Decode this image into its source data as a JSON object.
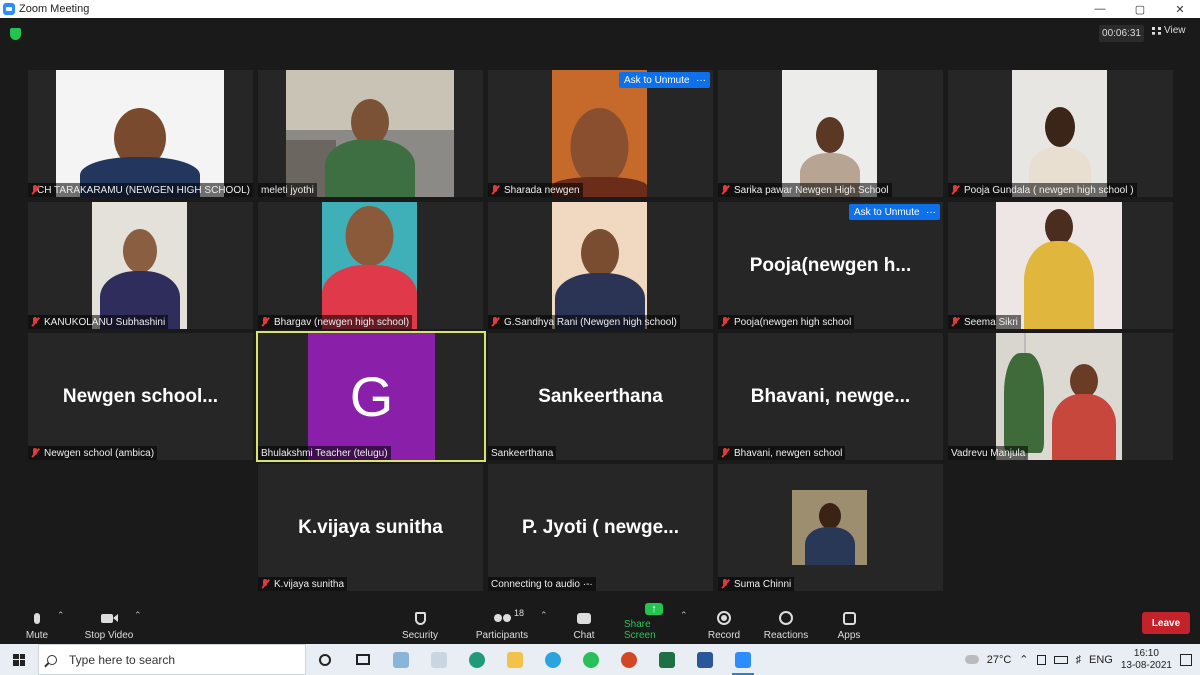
{
  "window": {
    "title": "Zoom Meeting",
    "controls": [
      "—",
      "▢",
      "✕"
    ]
  },
  "header": {
    "timer": "00:06:31",
    "view_label": "View"
  },
  "unmute": {
    "label": "Ask to Unmute",
    "more": "···"
  },
  "participants": {
    "p1": {
      "name": "CH TARAKARAMU (NEWGEN HIGH SCHOOL)"
    },
    "p2": {
      "name": "meleti jyothi"
    },
    "p3": {
      "name": "Sharada newgen"
    },
    "p4": {
      "name": "Sarika pawar Newgen High School"
    },
    "p5": {
      "name": "Pooja Gundala ( newgen high  school )"
    },
    "p6": {
      "name": "KANUKOLANU Subhashini"
    },
    "p7": {
      "name": "Bhargav (newgen high school)"
    },
    "p8": {
      "name": "G.Sandhya Rani (Newgen high school)"
    },
    "p9": {
      "name": "Pooja(newgen high school",
      "display": "Pooja(newgen  h..."
    },
    "p10": {
      "name": "Seema Sikri"
    },
    "p11": {
      "name": "Newgen school (ambica)",
      "display": "Newgen  school..."
    },
    "p12": {
      "name": "Bhulakshmi Teacher (telugu)",
      "initial": "G"
    },
    "p13": {
      "name": "Sankeerthana",
      "display": "Sankeerthana"
    },
    "p14": {
      "name": "Bhavani, newgen school",
      "display": "Bhavani,  newge..."
    },
    "p15": {
      "name": "Vadrevu Manjula"
    },
    "p16": {
      "name": "K.vijaya sunitha",
      "display": "K.vijaya sunitha"
    },
    "p17": {
      "name": "Connecting to audio ·-·",
      "display": "P. Jyoti  ( newge..."
    },
    "p18": {
      "name": "Suma Chinni"
    }
  },
  "toolbar": {
    "mute": "Mute",
    "stop_video": "Stop Video",
    "security": "Security",
    "participants": "Participants",
    "participants_count": "18",
    "chat": "Chat",
    "share_screen": "Share Screen",
    "record": "Record",
    "reactions": "Reactions",
    "apps": "Apps",
    "leave": "Leave"
  },
  "taskbar": {
    "search_placeholder": "Type here to search",
    "weather": "27°C",
    "lang": "ENG",
    "time": "16:10",
    "date": "13-08-2021"
  },
  "colors": {
    "active_speaker_border": "#d7e56b",
    "unmute_blue": "#0e71eb",
    "leave_red": "#c4222a",
    "share_green": "#23c552"
  }
}
